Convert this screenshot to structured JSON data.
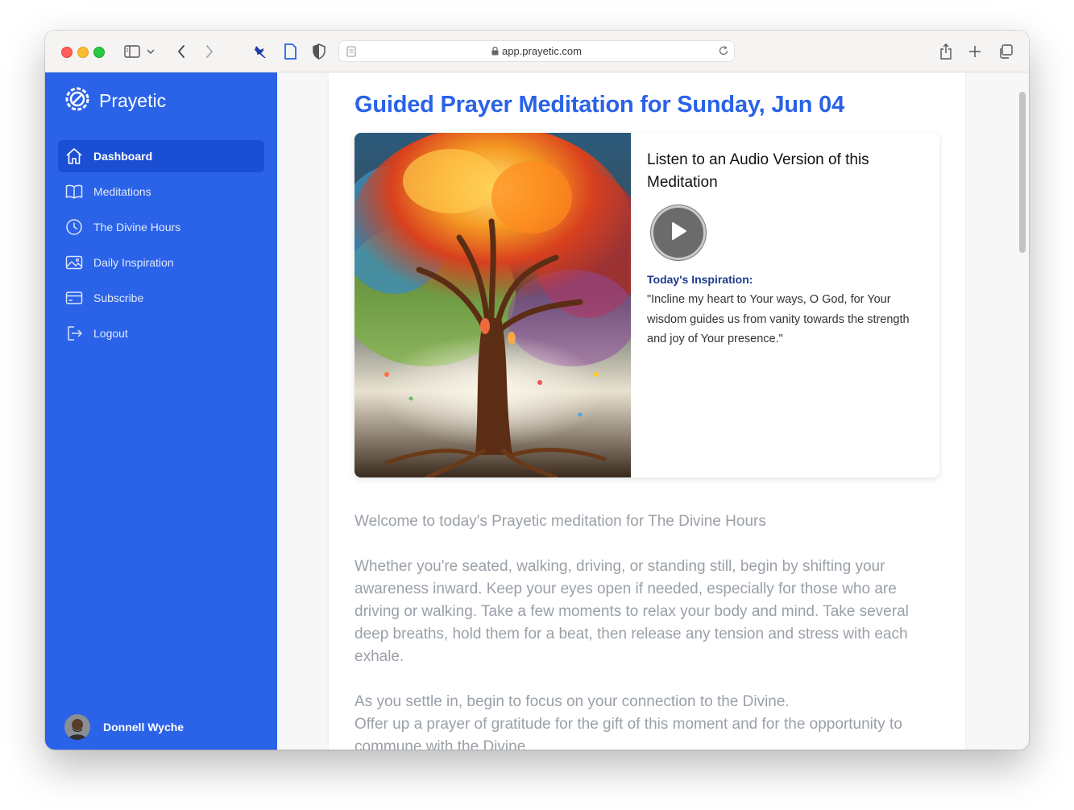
{
  "browser": {
    "url": "app.prayetic.com"
  },
  "sidebar": {
    "brand": "Prayetic",
    "items": [
      {
        "label": "Dashboard",
        "icon": "home-icon",
        "active": true
      },
      {
        "label": "Meditations",
        "icon": "book-icon",
        "active": false
      },
      {
        "label": "The Divine Hours",
        "icon": "clock-icon",
        "active": false
      },
      {
        "label": "Daily Inspiration",
        "icon": "image-icon",
        "active": false
      },
      {
        "label": "Subscribe",
        "icon": "credit-card-icon",
        "active": false
      },
      {
        "label": "Logout",
        "icon": "logout-icon",
        "active": false
      }
    ],
    "user": {
      "name": "Donnell Wyche"
    }
  },
  "main": {
    "title": "Guided Prayer Meditation for Sunday, Jun 04",
    "audio": {
      "heading": "Listen to an Audio Version of this Meditation"
    },
    "inspiration": {
      "label": "Today's Inspiration:",
      "quote": "\"Incline my heart to Your ways, O God, for Your wisdom guides us from vanity towards the strength and joy of Your presence.\""
    },
    "body": {
      "p1": "Welcome to today's Prayetic meditation for The Divine Hours",
      "p2": "Whether you're seated, walking, driving, or standing still, begin by shifting your awareness inward. Keep your eyes open if needed, especially for those who are driving or walking. Take a few moments to relax your body and mind. Take several deep breaths, hold them for a beat, then release any tension and stress with each exhale.",
      "p3a": "As you settle in, begin to focus on your connection to the Divine.",
      "p3b": "Offer up a prayer of gratitude for the gift of this moment and for the opportunity to commune with the Divine."
    }
  },
  "colors": {
    "sidebar": "#2a62e8",
    "sidebar_active": "#1a4fd4",
    "title": "#2a62e8",
    "inspiration_label": "#1e3a8a",
    "body_text": "#9aa0a8"
  }
}
